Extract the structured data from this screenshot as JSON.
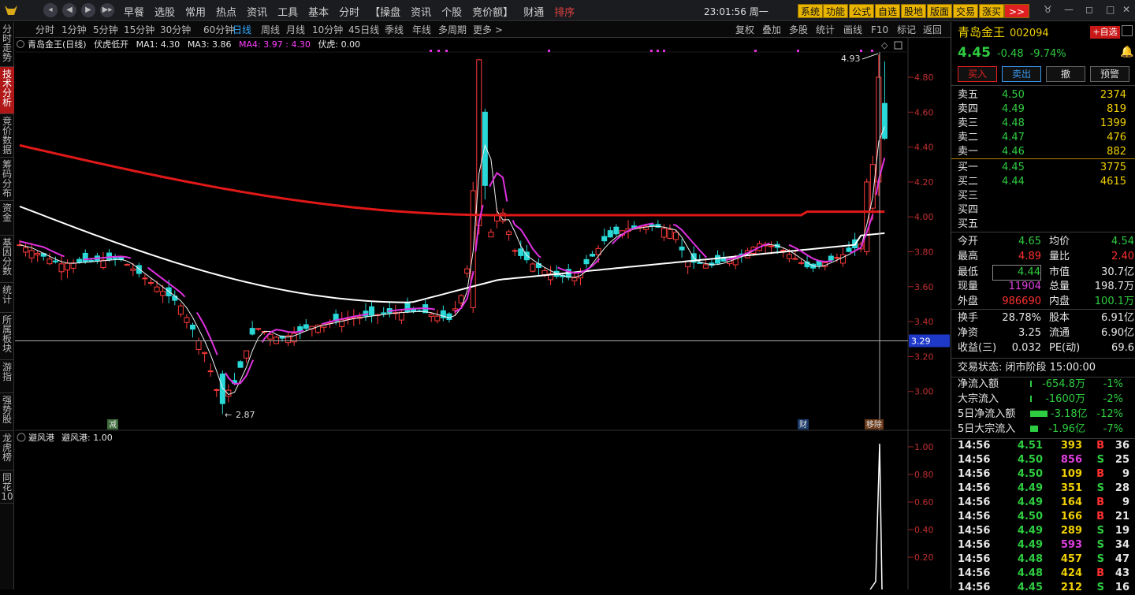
{
  "topbar": {
    "nav": [
      "◂",
      "◀",
      "▶",
      "▶▸"
    ],
    "menus": [
      "早餐",
      "选股",
      "常用",
      "热点",
      "资讯",
      "工具",
      "基本",
      "分时",
      "【操盘",
      "资讯",
      "个股",
      "竞价额】",
      "财通",
      "排序"
    ],
    "clock": "23:01:56 周一",
    "buttons": [
      "系统",
      "功能",
      "公式",
      "自选",
      "股地",
      "版面",
      "交易",
      "涨买",
      ">>"
    ]
  },
  "lefttabs": [
    "分时走势",
    "技术分析",
    "竞价数据",
    "筹码分布",
    "资金",
    "基因分数",
    "统计",
    "所属板块",
    "游指",
    "强势股",
    "龙虎榜",
    "同花10"
  ],
  "periods": {
    "left": [
      "分时",
      "1分钟",
      "5分钟",
      "15分钟",
      "30分钟",
      "60分钟",
      "日线",
      "周线",
      "月线",
      "10分钟",
      "45日线",
      "季线",
      "年线",
      "多周期",
      "更多 >"
    ],
    "right": [
      "复权",
      "叠加",
      "多股",
      "统计",
      "画线",
      "F10",
      "标记",
      "返回"
    ]
  },
  "indicator": {
    "name": "青岛金王(日线)",
    "main": "伏虎低开",
    "ma1": "MA1: 4.30",
    "ma3": "MA3: 3.86",
    "ma4": "MA4: 3.97 : 4.30",
    "fuhu": "伏虎: 0.00"
  },
  "chart": {
    "high_label": "4.93",
    "low_label": "2.87",
    "price_ticks": [
      "4.80",
      "4.60",
      "4.40",
      "4.20",
      "4.00",
      "3.80",
      "3.60",
      "3.40",
      "3.20",
      "3.00"
    ],
    "cross_price": "3.29",
    "markers": [
      "减",
      "财",
      "移除"
    ]
  },
  "sub": {
    "name": "避风港",
    "value": "避风港: 1.00",
    "ticks": [
      "1.00",
      "0.80",
      "0.60",
      "0.40",
      "0.20"
    ]
  },
  "stock": {
    "name": "青岛金王",
    "code": "002094",
    "price": "4.45",
    "change": "-0.48",
    "pct": "-9.74%",
    "addfav": "+自选"
  },
  "trade_buttons": [
    "买入",
    "卖出",
    "撤",
    "预警"
  ],
  "asks": [
    {
      "l": "卖五",
      "p": "4.50",
      "v": "2374"
    },
    {
      "l": "卖四",
      "p": "4.49",
      "v": "819"
    },
    {
      "l": "卖三",
      "p": "4.48",
      "v": "1399"
    },
    {
      "l": "卖二",
      "p": "4.47",
      "v": "476"
    },
    {
      "l": "卖一",
      "p": "4.46",
      "v": "882"
    }
  ],
  "bids": [
    {
      "l": "买一",
      "p": "4.45",
      "v": "3775"
    },
    {
      "l": "买二",
      "p": "4.44",
      "v": "4615"
    },
    {
      "l": "买三",
      "p": "",
      "v": ""
    },
    {
      "l": "买四",
      "p": "",
      "v": ""
    },
    {
      "l": "买五",
      "p": "",
      "v": ""
    }
  ],
  "stats": [
    [
      "今开",
      "4.65",
      "均价",
      "4.54"
    ],
    [
      "最高",
      "4.89",
      "量比",
      "2.40"
    ],
    [
      "最低",
      "4.44",
      "市值",
      "30.7亿"
    ],
    [
      "现量",
      "11904",
      "总量",
      "198.7万"
    ],
    [
      "外盘",
      "986690",
      "内盘",
      "100.1万"
    ]
  ],
  "stats2": [
    [
      "换手",
      "28.78%",
      "股本",
      "6.91亿"
    ],
    [
      "净资",
      "3.25",
      "流通",
      "6.90亿"
    ],
    [
      "收益(三)",
      "0.032",
      "PE(动)",
      "69.6"
    ]
  ],
  "status": "交易状态: 闭市阶段 15:00:00",
  "flows": [
    [
      "净流入额",
      "-654.8万",
      "-1%"
    ],
    [
      "大宗流入",
      "-1600万",
      "-2%"
    ],
    [
      "5日净流入额",
      "-3.18亿",
      "-12%"
    ],
    [
      "5日大宗流入",
      "-1.96亿",
      "-7%"
    ]
  ],
  "ticks": [
    [
      "14:56",
      "4.51",
      "393",
      "B",
      "36"
    ],
    [
      "14:56",
      "4.50",
      "856",
      "S",
      "25"
    ],
    [
      "14:56",
      "4.50",
      "109",
      "B",
      "9"
    ],
    [
      "14:56",
      "4.49",
      "351",
      "S",
      "28"
    ],
    [
      "14:56",
      "4.49",
      "164",
      "B",
      "9"
    ],
    [
      "14:56",
      "4.50",
      "166",
      "B",
      "21"
    ],
    [
      "14:56",
      "4.49",
      "289",
      "S",
      "19"
    ],
    [
      "14:56",
      "4.49",
      "593",
      "S",
      "34"
    ],
    [
      "14:56",
      "4.48",
      "457",
      "S",
      "47"
    ],
    [
      "14:56",
      "4.48",
      "424",
      "B",
      "43"
    ],
    [
      "14:56",
      "4.45",
      "212",
      "S",
      "16"
    ]
  ]
}
